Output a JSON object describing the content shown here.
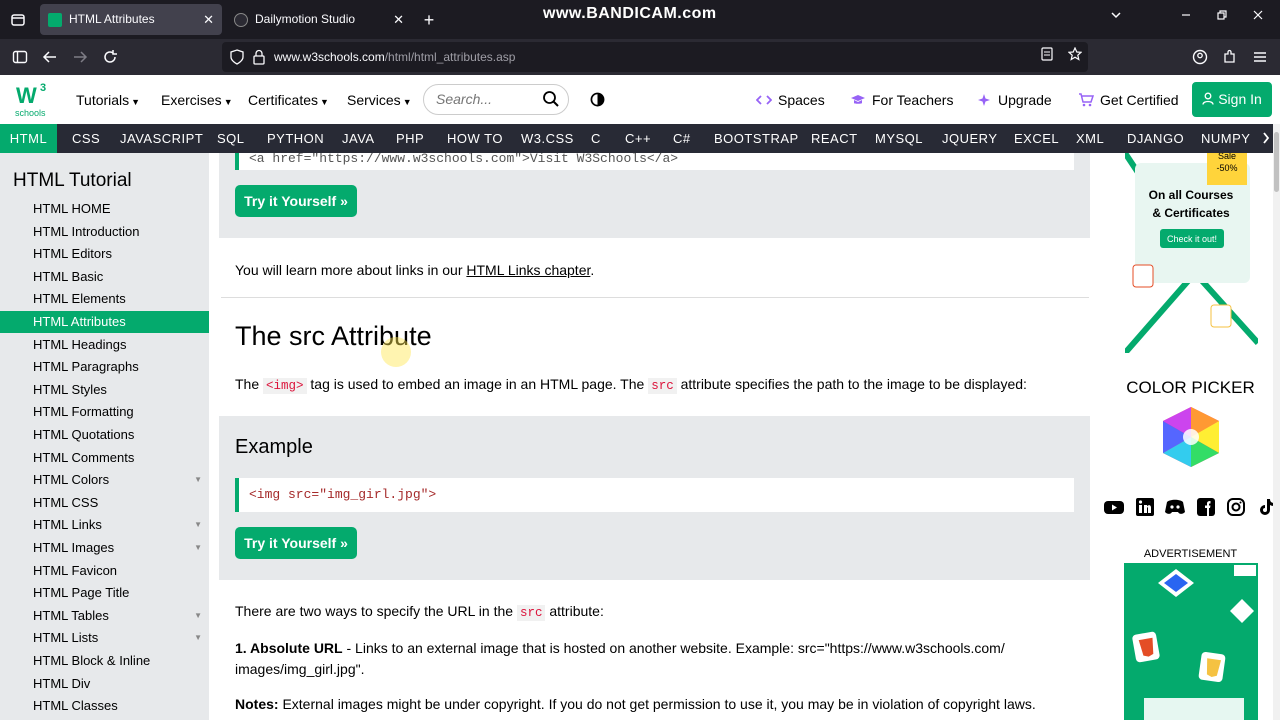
{
  "browser": {
    "tabs": [
      {
        "title": "HTML Attributes",
        "active": true
      },
      {
        "title": "Dailymotion Studio",
        "active": false
      }
    ],
    "new_tab": "+",
    "watermark": "www.BANDICAM.com",
    "url_host": "www.w3schools.com",
    "url_path": "/html/html_attributes.asp",
    "close_glyph": "✕"
  },
  "header": {
    "logo_text": "schools",
    "menus": [
      "Tutorials",
      "Exercises",
      "Certificates",
      "Services"
    ],
    "search_placeholder": "Search...",
    "right_links": [
      "Spaces",
      "For Teachers",
      "Upgrade",
      "Get Certified"
    ],
    "signin": "Sign In",
    "accent": "#04aa6d"
  },
  "topics": [
    "HTML",
    "CSS",
    "JAVASCRIPT",
    "SQL",
    "PYTHON",
    "JAVA",
    "PHP",
    "HOW TO",
    "W3.CSS",
    "C",
    "C++",
    "C#",
    "BOOTSTRAP",
    "REACT",
    "MYSQL",
    "JQUERY",
    "EXCEL",
    "XML",
    "DJANGO",
    "NUMPY"
  ],
  "sidebar": {
    "title": "HTML Tutorial",
    "items": [
      {
        "label": "HTML HOME"
      },
      {
        "label": "HTML Introduction"
      },
      {
        "label": "HTML Editors"
      },
      {
        "label": "HTML Basic"
      },
      {
        "label": "HTML Elements"
      },
      {
        "label": "HTML Attributes",
        "active": true
      },
      {
        "label": "HTML Headings"
      },
      {
        "label": "HTML Paragraphs"
      },
      {
        "label": "HTML Styles"
      },
      {
        "label": "HTML Formatting"
      },
      {
        "label": "HTML Quotations"
      },
      {
        "label": "HTML Comments"
      },
      {
        "label": "HTML Colors",
        "expandable": true
      },
      {
        "label": "HTML CSS"
      },
      {
        "label": "HTML Links",
        "expandable": true
      },
      {
        "label": "HTML Images",
        "expandable": true
      },
      {
        "label": "HTML Favicon"
      },
      {
        "label": "HTML Page Title"
      },
      {
        "label": "HTML Tables",
        "expandable": true
      },
      {
        "label": "HTML Lists",
        "expandable": true
      },
      {
        "label": "HTML Block & Inline"
      },
      {
        "label": "HTML Div"
      },
      {
        "label": "HTML Classes"
      }
    ]
  },
  "main": {
    "prev_code": "<a href=\"https://www.w3schools.com\">Visit W3Schools</a>",
    "try_button": "Try it Yourself »",
    "links_text_before": "You will learn more about links in our ",
    "links_link": "HTML Links chapter",
    "links_text_after": ".",
    "section_title": "The src Attribute",
    "src_p_1": "The ",
    "src_tag": "<img>",
    "src_p_2": " tag is used to embed an image in an HTML page. The ",
    "src_attr": "src",
    "src_p_3": " attribute specifies the path to the image to be displayed:",
    "example_heading": "Example",
    "example_code": "<img src=\"img_girl.jpg\">",
    "ways_before": "There are two ways to specify the URL in the ",
    "ways_code": "src",
    "ways_after": " attribute:",
    "abs_bold": "1. Absolute URL",
    "abs_text": " - Links to an external image that is hosted on another website. Example: src=\"https://www.w3schools.com/",
    "abs_text_2": "images/img_girl.jpg\".",
    "notes_bold": "Notes:",
    "notes_text": " External images might be under copyright. If you do not get permission to use it, you may be in violation of copyright laws."
  },
  "rail": {
    "ad_sale": "Sale",
    "ad_discount": "-50%",
    "ad_line1": "On all Courses",
    "ad_line2": "& Certificates",
    "ad_button": "Check it out!",
    "color_picker": "COLOR PICKER",
    "advertisement": "ADVERTISEMENT"
  }
}
